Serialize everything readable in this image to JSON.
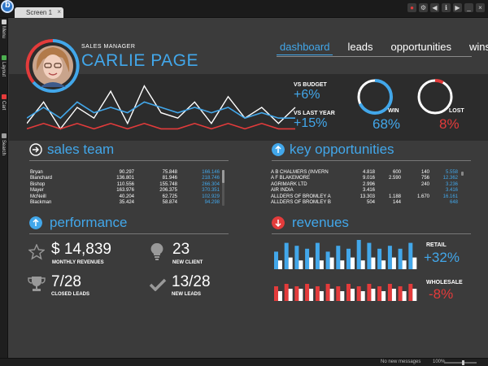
{
  "window": {
    "tab_label": "Screen 1",
    "tab_close": "×"
  },
  "sidebar": {
    "items": [
      {
        "label": "Menu",
        "color": "#cfcfcf"
      },
      {
        "label": "Layout",
        "color": "#4caf50"
      },
      {
        "label": "Cart",
        "color": "#e53b3b"
      },
      {
        "label": "Search",
        "color": "#9e9e9e"
      }
    ]
  },
  "profile": {
    "role": "SALES MANAGER",
    "name": "CARLIE PAGE",
    "avatar_icon": "user-photo"
  },
  "nav": {
    "items": [
      {
        "label": "dashboard",
        "active": true
      },
      {
        "label": "leads",
        "active": false
      },
      {
        "label": "opportunities",
        "active": false
      },
      {
        "label": "wins",
        "active": false
      }
    ]
  },
  "kpis": {
    "vs_budget_label": "VS BUDGET",
    "vs_budget_value": "+6%",
    "vs_last_year_label": "VS LAST YEAR",
    "vs_last_year_value": "+15%",
    "win_label": "WIN",
    "win_value": "68%",
    "win_fraction": 0.68,
    "lost_label": "LOST",
    "lost_value": "8%",
    "lost_fraction": 0.08
  },
  "sales_team": {
    "title": "sales team",
    "icon": "arrow-right-circle-icon",
    "rows": [
      [
        "Bryan",
        "90.297",
        "75.848",
        "166.146"
      ],
      [
        "Blanchard",
        "136.801",
        "81.946",
        "218.746"
      ],
      [
        "Bishop",
        "110.556",
        "155.748",
        "266.304"
      ],
      [
        "Mayer",
        "163.976",
        "206.375",
        "370.351"
      ],
      [
        "McNeill",
        "40.204",
        "62.725",
        "102.929"
      ],
      [
        "Blackman",
        "35.424",
        "58.874",
        "94.298"
      ]
    ]
  },
  "key_opportunities": {
    "title": "key opportunities",
    "icon": "arrow-up-circle-icon",
    "rows": [
      [
        "A B CHALMERS (INVERN",
        "4.818",
        "600",
        "140",
        "5.558"
      ],
      [
        "A F BLAKEMORE",
        "9.016",
        "2.590",
        "756",
        "12.362"
      ],
      [
        "AGRIMARK LTD",
        "2.996",
        "",
        "240",
        "3.236"
      ],
      [
        "AIR INDIA",
        "3.416",
        "",
        "",
        "3.416"
      ],
      [
        "ALLDERS OF BROMLEY A",
        "13.303",
        "1.188",
        "1.670",
        "16.161"
      ],
      [
        "ALLDERS OF BROMLEY B",
        "504",
        "144",
        "",
        "648"
      ]
    ]
  },
  "performance": {
    "title": "performance",
    "icon": "arrow-up-circle-icon",
    "monthly_revenues_value": "$ 14,839",
    "monthly_revenues_label": "MONTHLY REVENUES",
    "new_client_value": "23",
    "new_client_label": "NEW CLIENT",
    "closed_leads_value": "7/28",
    "closed_leads_label": "CLOSED LEADS",
    "new_leads_value": "13/28",
    "new_leads_label": "NEW LEADS"
  },
  "revenues": {
    "title": "revenues",
    "icon": "arrow-down-circle-icon",
    "retail_label": "RETAIL",
    "retail_value": "+32%",
    "wholesale_label": "WHOLESALE",
    "wholesale_value": "-8%"
  },
  "status": {
    "messages": "No new messages",
    "zoom": "100%"
  },
  "colors": {
    "accent": "#42a7ea",
    "negative": "#e33b3b",
    "panel": "#2c2c2c",
    "background": "#3b3b3b"
  },
  "chart_data": [
    {
      "type": "line",
      "series": [
        {
          "color": "#ffffff",
          "values": [
            2,
            6,
            1,
            5,
            3,
            8,
            2,
            9,
            4,
            3,
            6,
            2,
            7,
            3,
            5,
            2,
            5
          ]
        },
        {
          "color": "#42a7ea",
          "values": [
            3,
            5,
            3,
            6,
            4,
            5,
            4,
            6,
            5,
            4,
            5,
            4,
            5,
            3,
            4,
            3,
            3
          ]
        },
        {
          "color": "#e33b3b",
          "values": [
            1,
            2,
            1,
            2,
            1,
            2,
            1,
            2,
            1,
            1,
            2,
            1,
            2,
            1,
            2,
            1,
            1
          ]
        }
      ]
    },
    {
      "type": "bar",
      "series": [
        {
          "color": "#42a7ea",
          "values": [
            6,
            9,
            8,
            7,
            9,
            6,
            8,
            7,
            10,
            9,
            7,
            8,
            7,
            9
          ]
        },
        {
          "color": "#ffffff",
          "values": [
            3,
            4,
            3,
            4,
            3,
            4,
            3,
            4,
            3,
            4,
            3,
            4,
            3,
            4
          ]
        }
      ]
    },
    {
      "type": "bar",
      "series": [
        {
          "color": "#e33b3b",
          "values": [
            6,
            7,
            6,
            7,
            6,
            7,
            6,
            7,
            6,
            7,
            6,
            7,
            6,
            7
          ]
        },
        {
          "color": "#ffffff",
          "values": [
            4,
            5,
            5,
            5,
            4,
            5,
            4,
            5,
            4,
            5,
            4,
            5,
            4,
            5
          ]
        }
      ]
    }
  ]
}
